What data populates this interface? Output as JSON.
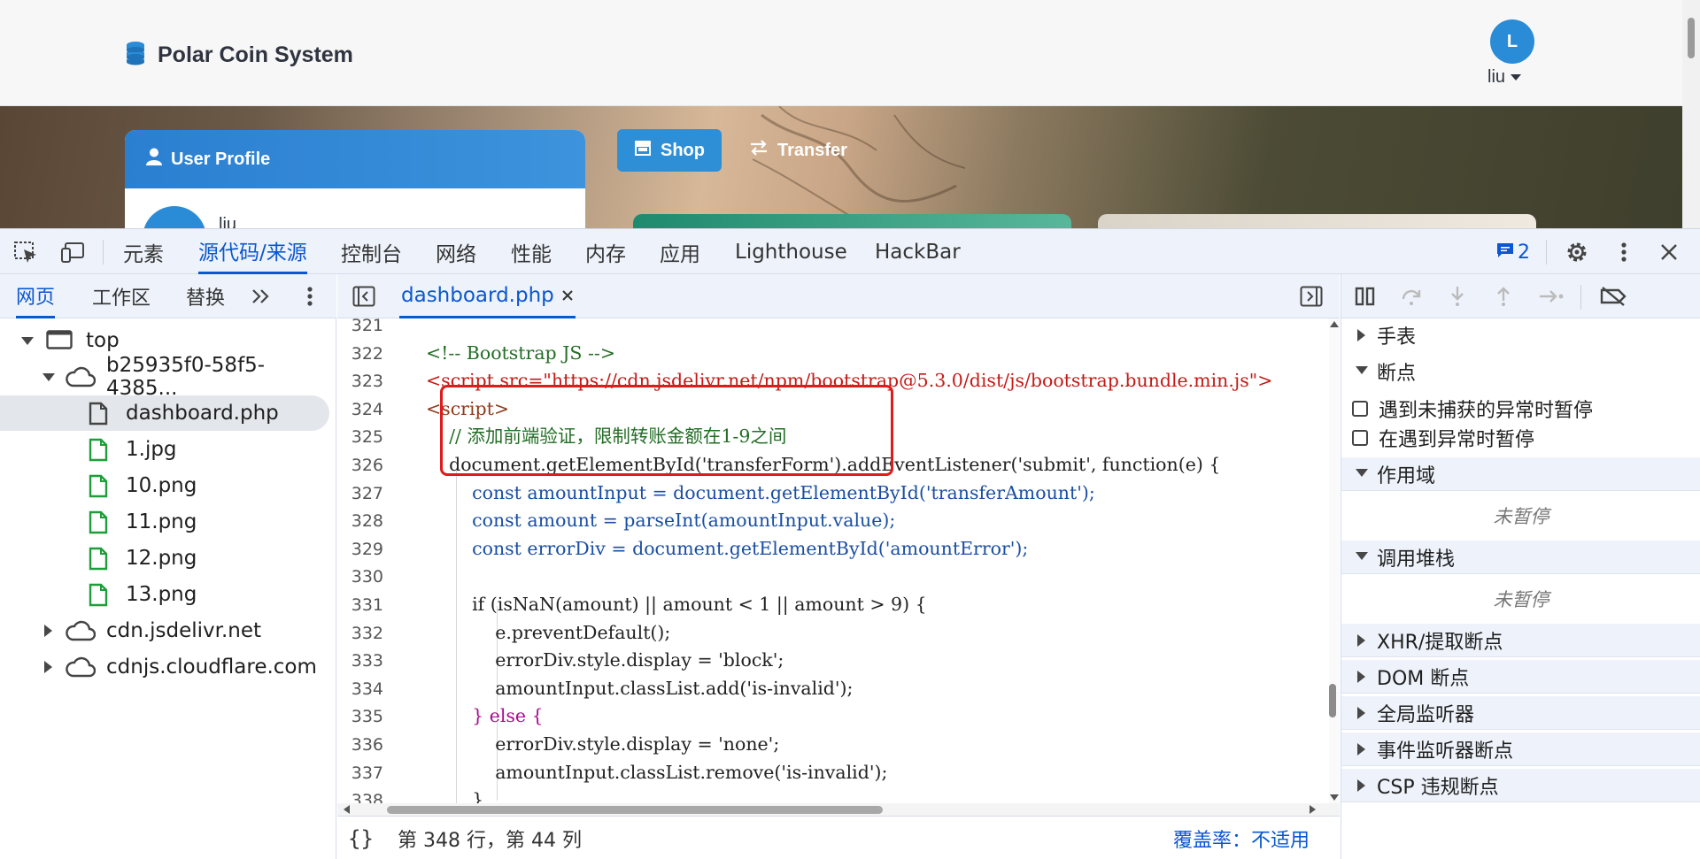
{
  "webpage": {
    "brand": "Polar Coin System",
    "avatar_initial": "L",
    "username": "liu",
    "profile_card_title": "User Profile",
    "profile_name": "liu",
    "shop_label": "Shop",
    "transfer_label": "Transfer"
  },
  "devtools": {
    "main_tabs": [
      "元素",
      "源代码/来源",
      "控制台",
      "网络",
      "性能",
      "内存",
      "应用",
      "Lighthouse",
      "HackBar"
    ],
    "active_main_tab": "源代码/来源",
    "message_count": "2",
    "navigator_tabs": [
      "网页",
      "工作区",
      "替换"
    ],
    "active_navigator_tab": "网页",
    "file_tree": [
      {
        "label": "top",
        "type": "frame",
        "expanded": true
      },
      {
        "label": "b25935f0-58f5-4385...",
        "type": "domain",
        "expanded": true
      },
      {
        "label": "dashboard.php",
        "type": "file",
        "selected": true
      },
      {
        "label": "1.jpg",
        "type": "image"
      },
      {
        "label": "10.png",
        "type": "image"
      },
      {
        "label": "11.png",
        "type": "image"
      },
      {
        "label": "12.png",
        "type": "image"
      },
      {
        "label": "13.png",
        "type": "image"
      },
      {
        "label": "cdn.jsdelivr.net",
        "type": "domain",
        "expanded": false
      },
      {
        "label": "cdnjs.cloudflare.com",
        "type": "domain",
        "expanded": false
      }
    ],
    "open_file": "dashboard.php",
    "code_lines": [
      {
        "n": "321",
        "text": ""
      },
      {
        "n": "322",
        "text": "<!-- Bootstrap JS -->"
      },
      {
        "n": "323",
        "text": "<script src=\"https://cdn.jsdelivr.net/npm/bootstrap@5.3.0/dist/js/bootstrap.bundle.min.js\">"
      },
      {
        "n": "324",
        "text": "<script>"
      },
      {
        "n": "325",
        "text": "    // 添加前端验证，限制转账金额在1-9之间"
      },
      {
        "n": "326",
        "text": "    document.getElementById('transferForm').addEventListener('submit', function(e) {"
      },
      {
        "n": "327",
        "text": "        const amountInput = document.getElementById('transferAmount');"
      },
      {
        "n": "328",
        "text": "        const amount = parseInt(amountInput.value);"
      },
      {
        "n": "329",
        "text": "        const errorDiv = document.getElementById('amountError');"
      },
      {
        "n": "330",
        "text": ""
      },
      {
        "n": "331",
        "text": "        if (isNaN(amount) || amount < 1 || amount > 9) {"
      },
      {
        "n": "332",
        "text": "            e.preventDefault();"
      },
      {
        "n": "333",
        "text": "            errorDiv.style.display = 'block';"
      },
      {
        "n": "334",
        "text": "            amountInput.classList.add('is-invalid');"
      },
      {
        "n": "335",
        "text": "        } else {"
      },
      {
        "n": "336",
        "text": "            errorDiv.style.display = 'none';"
      },
      {
        "n": "337",
        "text": "            amountInput.classList.remove('is-invalid');"
      },
      {
        "n": "338",
        "text": "        }"
      }
    ],
    "status_position": "第 348 行，第 44 列",
    "status_coverage": "覆盖率：不适用",
    "debugger": {
      "sections": {
        "watch": "手表",
        "breakpoints": "断点",
        "scope": "作用域",
        "call_stack": "调用堆栈",
        "xhr": "XHR/提取断点",
        "dom": "DOM 断点",
        "global_listeners": "全局监听器",
        "event_listeners": "事件监听器断点",
        "csp": "CSP 违规断点"
      },
      "pause_uncaught": "遇到未捕获的异常时暂停",
      "pause_caught": "在遇到异常时暂停",
      "not_paused": "未暂停"
    }
  },
  "colors": {
    "accent": "#0b57d0",
    "brand_blue": "#2a8bd6",
    "highlight_box": "#e01b1b",
    "tab_bar": "#eef3fb"
  }
}
